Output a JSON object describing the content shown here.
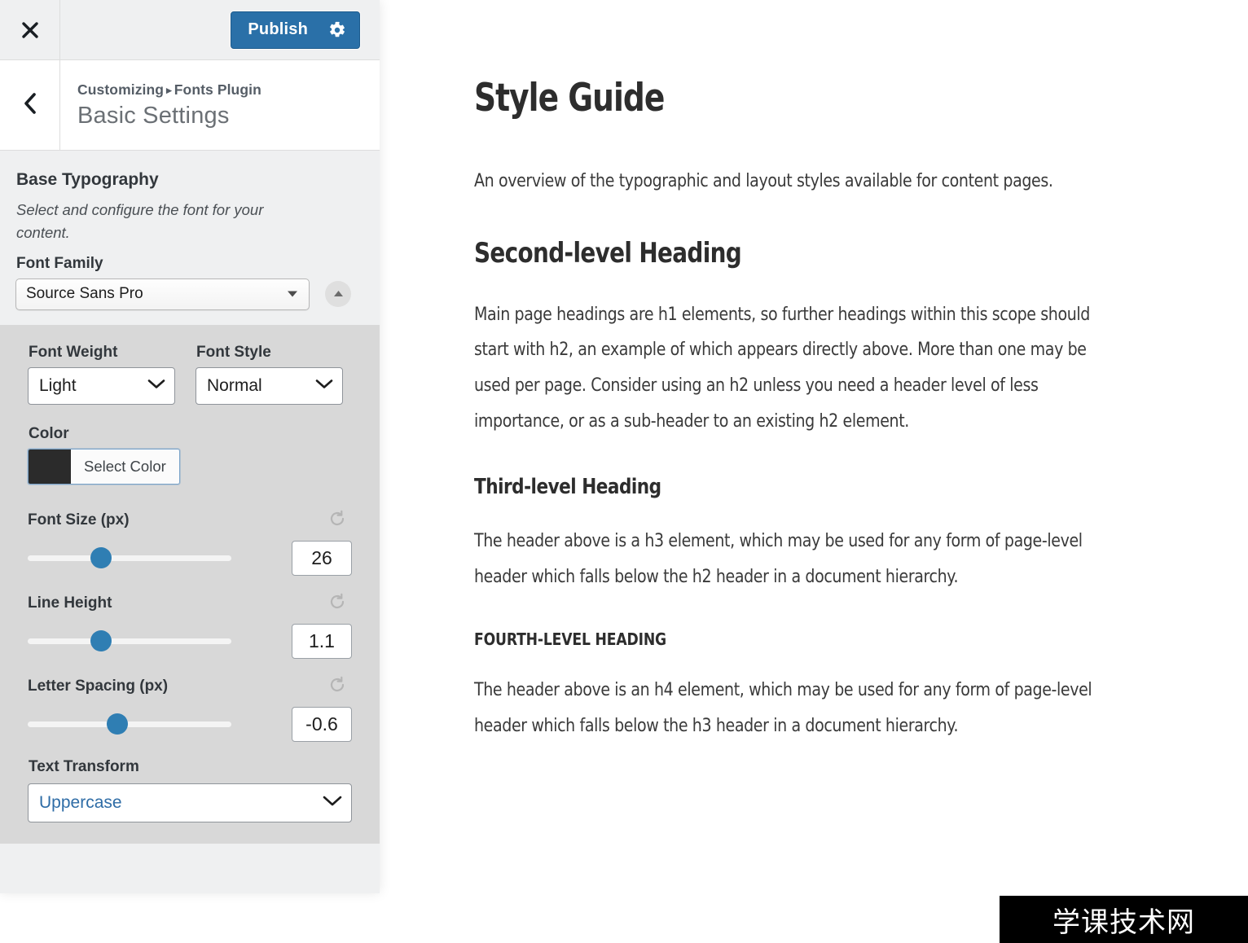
{
  "customizer": {
    "topbar": {
      "close_icon": "close-icon",
      "publish_label": "Publish",
      "gear_icon": "gear-icon",
      "publish_color": "#2a70a8"
    },
    "header": {
      "back_icon": "chevron-left-icon",
      "breadcrumb_root": "Customizing",
      "breadcrumb_sep": "▸",
      "breadcrumb_current": "Fonts Plugin",
      "title": "Basic Settings"
    },
    "section": {
      "title": "Base Typography",
      "description": "Select and configure the font for your content.",
      "font_family": {
        "label": "Font Family",
        "value": "Source Sans Pro",
        "caret_icon": "caret-down-icon",
        "toggle_icon": "caret-up-icon"
      },
      "font_weight": {
        "label": "Font Weight",
        "value": "Light",
        "chevron_icon": "chevron-down-icon"
      },
      "font_style": {
        "label": "Font Style",
        "value": "Normal",
        "chevron_icon": "chevron-down-icon"
      },
      "color": {
        "label": "Color",
        "button_label": "Select Color",
        "swatch_hex": "#2b2b2b"
      },
      "font_size": {
        "label": "Font Size (px)",
        "value": "26",
        "slider_percent": 36,
        "reset_icon": "reset-icon"
      },
      "line_height": {
        "label": "Line Height",
        "value": "1.1",
        "slider_percent": 36,
        "reset_icon": "reset-icon"
      },
      "letter_spacing": {
        "label": "Letter Spacing (px)",
        "value": "-0.6",
        "slider_percent": 44,
        "reset_icon": "reset-icon"
      },
      "text_transform": {
        "label": "Text Transform",
        "value": "Uppercase",
        "chevron_icon": "chevron-down-icon"
      }
    }
  },
  "preview": {
    "h1": "Style Guide",
    "lead": "An overview of the typographic and layout styles available for content pages.",
    "h2": "Second-level Heading",
    "p2": "Main page headings are h1 elements, so further headings within this scope should start with h2, an example of which appears directly above. More than one may be used per page. Consider using an h2 unless you need a header level of less importance, or as a sub-header to an existing h2 element.",
    "h3": "Third-level Heading",
    "p3": "The header above is a h3 element, which may be used for any form of page-level header which falls below the h2 header in a document hierarchy.",
    "h4": "FOURTH-LEVEL HEADING",
    "p4": "The header above is an h4 element, which may be used for any form of page-level header which falls below the h3 header in a document hierarchy."
  },
  "watermark": {
    "text": "学课技术网"
  }
}
